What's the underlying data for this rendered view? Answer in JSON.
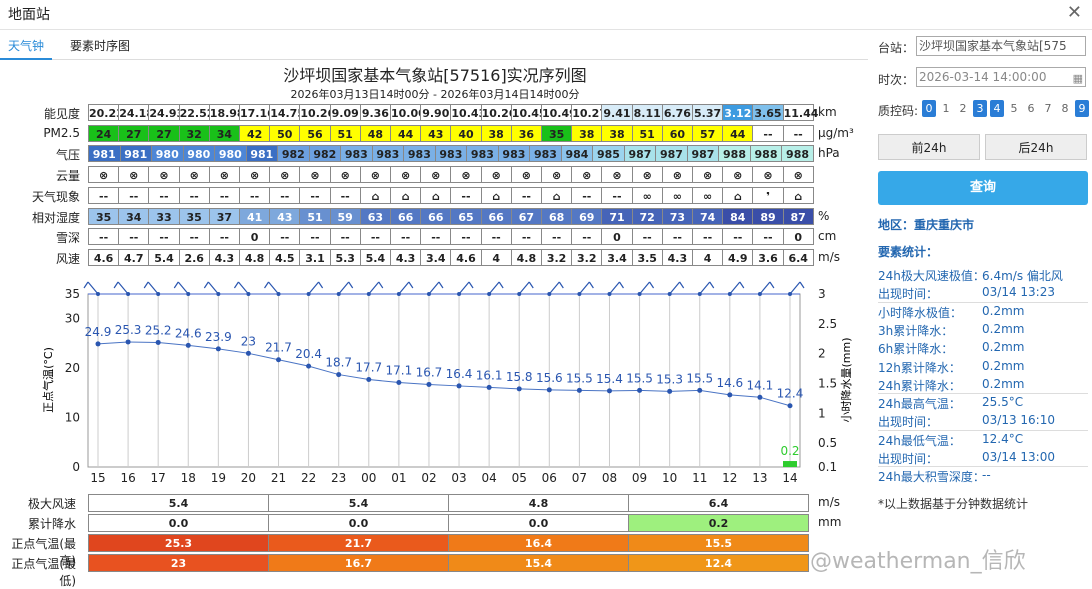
{
  "window": {
    "title": "地面站"
  },
  "tabs": [
    "天气钟",
    "要素时序图"
  ],
  "title": "沙坪坝国家基本气象站[57516]实况序列图",
  "subtitle": "2026年03月13日14时00分 - 2026年03月14日14时00分",
  "rows": [
    {
      "label": "能见度",
      "unit": "km",
      "values": [
        "20.23",
        "24.18",
        "24.93",
        "22.52",
        "18.98",
        "17.16",
        "14.75",
        "10.26",
        "9.09",
        "9.36",
        "10.00",
        "9.90",
        "10.43",
        "10.26",
        "10.45",
        "10.49",
        "10.27",
        "9.41",
        "8.11",
        "6.76",
        "5.37",
        "3.12",
        "3.65",
        "11.44"
      ],
      "colors": [
        "#fff",
        "#fff",
        "#fff",
        "#fff",
        "#fff",
        "#fff",
        "#fff",
        "#fff",
        "#fff",
        "#fff",
        "#fff",
        "#fff",
        "#fff",
        "#fff",
        "#fff",
        "#fff",
        "#fff",
        "#d8ecf8",
        "#d8ecf8",
        "#d8ecf8",
        "#d8ecf8",
        "#3d9be0",
        "#7fc0ec",
        "#fff"
      ]
    },
    {
      "label": "PM2.5",
      "unit": "μg/m³",
      "values": [
        "24",
        "27",
        "27",
        "32",
        "34",
        "42",
        "50",
        "56",
        "51",
        "48",
        "44",
        "43",
        "40",
        "38",
        "36",
        "35",
        "38",
        "38",
        "51",
        "60",
        "57",
        "44",
        "--",
        "--"
      ],
      "colors": [
        "#19c019",
        "#19c019",
        "#19c019",
        "#19c019",
        "#19c019",
        "#ffff00",
        "#ffff00",
        "#ffff00",
        "#ffff00",
        "#ffff00",
        "#ffff00",
        "#ffff00",
        "#ffff00",
        "#ffff00",
        "#ffff00",
        "#19c019",
        "#ffff00",
        "#ffff00",
        "#ffff00",
        "#ffff00",
        "#ffff00",
        "#ffff00",
        "#fff",
        "#fff"
      ]
    },
    {
      "label": "气压",
      "unit": "hPa",
      "values": [
        "981",
        "981",
        "980",
        "980",
        "980",
        "981",
        "982",
        "982",
        "983",
        "983",
        "983",
        "983",
        "983",
        "983",
        "983",
        "984",
        "985",
        "987",
        "987",
        "987",
        "988",
        "988",
        "988"
      ],
      "colors": [
        "#3b6fc4",
        "#3b6fc4",
        "#4d86d6",
        "#4d86d6",
        "#4d86d6",
        "#3b6fc4",
        "#6ca0e0",
        "#6ca0e0",
        "#7ab0e6",
        "#7ab0e6",
        "#7ab0e6",
        "#7ab0e6",
        "#7ab0e6",
        "#7ab0e6",
        "#7ab0e6",
        "#8cc4ec",
        "#9cd4ee",
        "#a8e2ea",
        "#a8e2ea",
        "#a8e2ea",
        "#b8efe8",
        "#b8efe8",
        "#b8efe8"
      ]
    },
    {
      "label": "云量",
      "unit": "",
      "values": [
        "⊗",
        "⊗",
        "⊗",
        "⊗",
        "⊗",
        "⊗",
        "⊗",
        "⊗",
        "⊗",
        "⊗",
        "⊗",
        "⊗",
        "⊗",
        "⊗",
        "⊗",
        "⊗",
        "⊗",
        "⊗",
        "⊗",
        "⊗",
        "⊗",
        "⊗",
        "⊗",
        "⊗"
      ]
    },
    {
      "label": "天气现象",
      "unit": "",
      "values": [
        "--",
        "--",
        "--",
        "--",
        "--",
        "--",
        "--",
        "--",
        "--",
        "⌂",
        "⌂",
        "⌂",
        "--",
        "⌂",
        "--",
        "⌂",
        "--",
        "--",
        "∞",
        "∞",
        "∞",
        "⌂",
        "❜",
        "⌂"
      ]
    },
    {
      "label": "相对湿度",
      "unit": "%",
      "values": [
        "35",
        "34",
        "33",
        "35",
        "37",
        "41",
        "43",
        "51",
        "59",
        "63",
        "66",
        "66",
        "65",
        "66",
        "67",
        "68",
        "69",
        "71",
        "72",
        "73",
        "74",
        "84",
        "89",
        "87"
      ],
      "colors": [
        "#9cc4ec",
        "#9cc4ec",
        "#9cc4ec",
        "#9cc4ec",
        "#9cc4ec",
        "#7ea8dc",
        "#7ea8dc",
        "#6890d0",
        "#6890d0",
        "#5478c4",
        "#5478c4",
        "#5478c4",
        "#5478c4",
        "#5478c4",
        "#5478c4",
        "#5478c4",
        "#5478c4",
        "#4664b8",
        "#4664b8",
        "#4664b8",
        "#4664b8",
        "#3a4ea8",
        "#3a4ea8",
        "#3a4ea8"
      ]
    },
    {
      "label": "雪深",
      "unit": "cm",
      "values": [
        "--",
        "--",
        "--",
        "--",
        "--",
        "0",
        "--",
        "--",
        "--",
        "--",
        "--",
        "--",
        "--",
        "--",
        "--",
        "--",
        "--",
        "0",
        "--",
        "--",
        "--",
        "--",
        "--",
        "0"
      ]
    },
    {
      "label": "风速",
      "unit": "m/s",
      "values": [
        "4.6",
        "4.7",
        "5.4",
        "2.6",
        "4.3",
        "4.8",
        "4.5",
        "3.1",
        "5.3",
        "5.4",
        "4.3",
        "3.4",
        "4.6",
        "4",
        "4.8",
        "3.2",
        "3.2",
        "3.4",
        "3.5",
        "4.3",
        "4",
        "4.9",
        "3.6",
        "6.4"
      ]
    }
  ],
  "chart_data": {
    "type": "line",
    "x": [
      "15",
      "16",
      "17",
      "18",
      "19",
      "20",
      "21",
      "22",
      "23",
      "00",
      "01",
      "02",
      "03",
      "04",
      "05",
      "06",
      "07",
      "08",
      "09",
      "10",
      "11",
      "12",
      "13",
      "14"
    ],
    "series": [
      {
        "values": [
          24.9,
          25.3,
          25.2,
          24.6,
          23.9,
          23,
          21.7,
          20.4,
          18.7,
          17.7,
          17.1,
          16.7,
          16.4,
          16.1,
          15.8,
          15.6,
          15.5,
          15.4,
          15.5,
          15.3,
          15.5,
          14.6,
          14.1,
          12.4
        ]
      }
    ],
    "precip": {
      "x": "14",
      "value": 0.2
    },
    "ylabel_left": "正点气温(°C)",
    "ylabel_right": "小时降水量(mm)",
    "yticks_left": [
      "0",
      "10",
      "20",
      "30",
      "35"
    ],
    "yticks_right": [
      "0.1",
      "0.5",
      "1",
      "1.5",
      "2",
      "2.5",
      "3"
    ],
    "ylim": [
      0,
      35
    ]
  },
  "bottom": {
    "rows": [
      {
        "label": "极大风速",
        "unit": "m/s",
        "values": [
          "5.4",
          "5.4",
          "4.8",
          "6.4"
        ]
      },
      {
        "label": "累计降水",
        "unit": "mm",
        "values": [
          "0.0",
          "0.0",
          "0.0",
          "0.2"
        ]
      },
      {
        "label": "正点气温(最高)",
        "unit": "",
        "values": [
          "25.3",
          "21.7",
          "16.4",
          "15.5"
        ]
      },
      {
        "label": "正点气温(最低)",
        "unit": "",
        "values": [
          "23",
          "16.7",
          "15.4",
          "12.4"
        ]
      }
    ]
  },
  "sidebar": {
    "station_label": "台站：",
    "station_value": "沙坪坝国家基本气象站[575",
    "time_label": "时次：",
    "time_value": "2026-03-14 14:00:00",
    "qc_label": "质控码:",
    "qc": [
      "0",
      "1",
      "2",
      "3",
      "4",
      "5",
      "6",
      "7",
      "8",
      "9"
    ],
    "prev": "前24h",
    "next": "后24h",
    "query": "查询",
    "region": "地区：重庆重庆市",
    "stats_title": "要素统计：",
    "stats": [
      [
        "24h极大风速极值：",
        "6.4m/s 偏北风"
      ],
      [
        "出现时间：",
        "03/14 13:23"
      ],
      [
        "小时降水极值：",
        "0.2mm"
      ],
      [
        "3h累计降水：",
        "0.2mm"
      ],
      [
        "6h累计降水：",
        "0.2mm"
      ],
      [
        "12h累计降水：",
        "0.2mm"
      ],
      [
        "24h累计降水：",
        "0.2mm"
      ],
      [
        "24h最高气温：",
        "25.5°C"
      ],
      [
        "出现时间：",
        "03/13 16:10"
      ],
      [
        "24h最低气温：",
        "12.4°C"
      ],
      [
        "出现时间：",
        "03/14 13:00"
      ],
      [
        "24h最大积雪深度：",
        "--"
      ]
    ],
    "note": "*以上数据基于分钟数据统计"
  },
  "watermark": "@weatherman_信欣"
}
